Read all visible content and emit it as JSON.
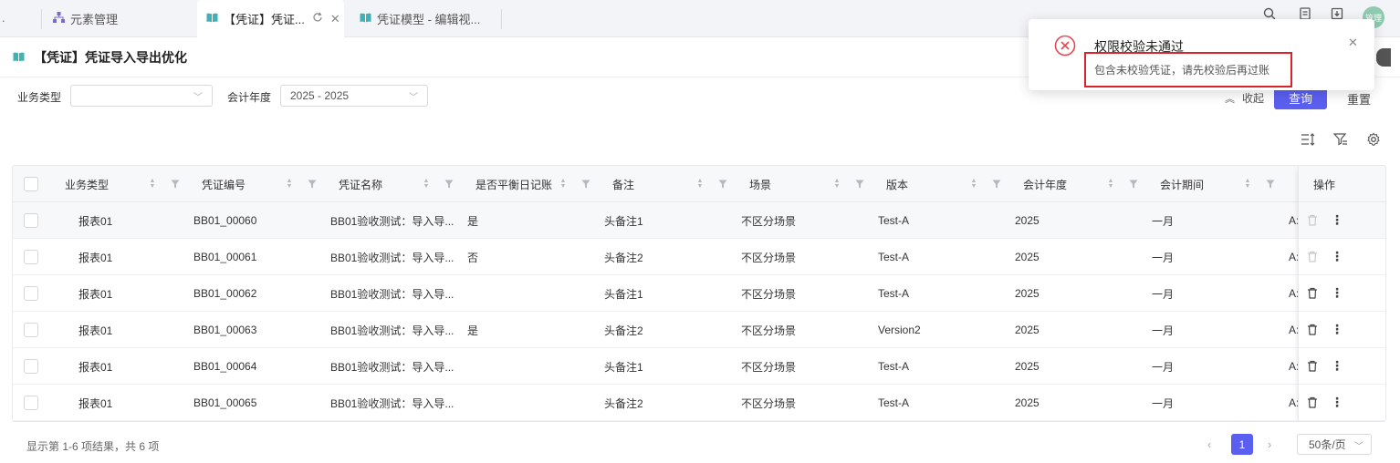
{
  "tabs": [
    {
      "label": "元素管理",
      "icon": "hierarchy-icon"
    },
    {
      "label": "【凭证】凭证...",
      "icon": "book-icon",
      "active": true
    },
    {
      "label": "凭证模型 - 编辑视...",
      "icon": "book-icon"
    }
  ],
  "tab_overflow_label": ".",
  "avatar_text": "管理",
  "page": {
    "title": "【凭证】凭证导入导出优化",
    "icon": "book-icon"
  },
  "filters": {
    "business_type_label": "业务类型",
    "business_type_value": "",
    "fiscal_year_label": "会计年度",
    "fiscal_year_value": "2025 - 2025"
  },
  "actions": {
    "collapse_label": "收起",
    "query_label": "查询",
    "reset_label": "重置"
  },
  "table": {
    "columns": [
      "业务类型",
      "凭证编号",
      "凭证名称",
      "是否平衡日记账",
      "备注",
      "场景",
      "版本",
      "会计年度",
      "会计期间",
      "",
      "操作"
    ],
    "rows": [
      {
        "business_type": "报表01",
        "voucher_no": "BB01_00060",
        "voucher_name": "BB01验收测试：导入导...",
        "balanced": "是",
        "remark": "头备注1",
        "scenario": "不区分场景",
        "version": "Test-A",
        "year": "2025",
        "period": "一月",
        "extra": "A:"
      },
      {
        "business_type": "报表01",
        "voucher_no": "BB01_00061",
        "voucher_name": "BB01验收测试：导入导...",
        "balanced": "否",
        "remark": "头备注2",
        "scenario": "不区分场景",
        "version": "Test-A",
        "year": "2025",
        "period": "一月",
        "extra": "A:"
      },
      {
        "business_type": "报表01",
        "voucher_no": "BB01_00062",
        "voucher_name": "BB01验收测试：导入导...",
        "balanced": "",
        "remark": "头备注1",
        "scenario": "不区分场景",
        "version": "Test-A",
        "year": "2025",
        "period": "一月",
        "extra": "A:"
      },
      {
        "business_type": "报表01",
        "voucher_no": "BB01_00063",
        "voucher_name": "BB01验收测试：导入导...",
        "balanced": "是",
        "remark": "头备注2",
        "scenario": "不区分场景",
        "version": "Version2",
        "year": "2025",
        "period": "一月",
        "extra": "A:"
      },
      {
        "business_type": "报表01",
        "voucher_no": "BB01_00064",
        "voucher_name": "BB01验收测试：导入导...",
        "balanced": "",
        "remark": "头备注1",
        "scenario": "不区分场景",
        "version": "Test-A",
        "year": "2025",
        "period": "一月",
        "extra": "A:"
      },
      {
        "business_type": "报表01",
        "voucher_no": "BB01_00065",
        "voucher_name": "BB01验收测试：导入导...",
        "balanced": "",
        "remark": "头备注2",
        "scenario": "不区分场景",
        "version": "Test-A",
        "year": "2025",
        "period": "一月",
        "extra": "A:"
      }
    ]
  },
  "footer": {
    "summary": "显示第 1-6 项结果，共 6 项",
    "current_page": "1",
    "page_size": "50条/页"
  },
  "toast": {
    "title": "权限校验未通过",
    "message": "包含未校验凭证，请先校验后再过账"
  },
  "colors": {
    "accent": "#5b5ff0",
    "error": "#d8232a",
    "tab_icon": "#3fb2b5",
    "hierarchy_icon": "#7b68c8"
  }
}
